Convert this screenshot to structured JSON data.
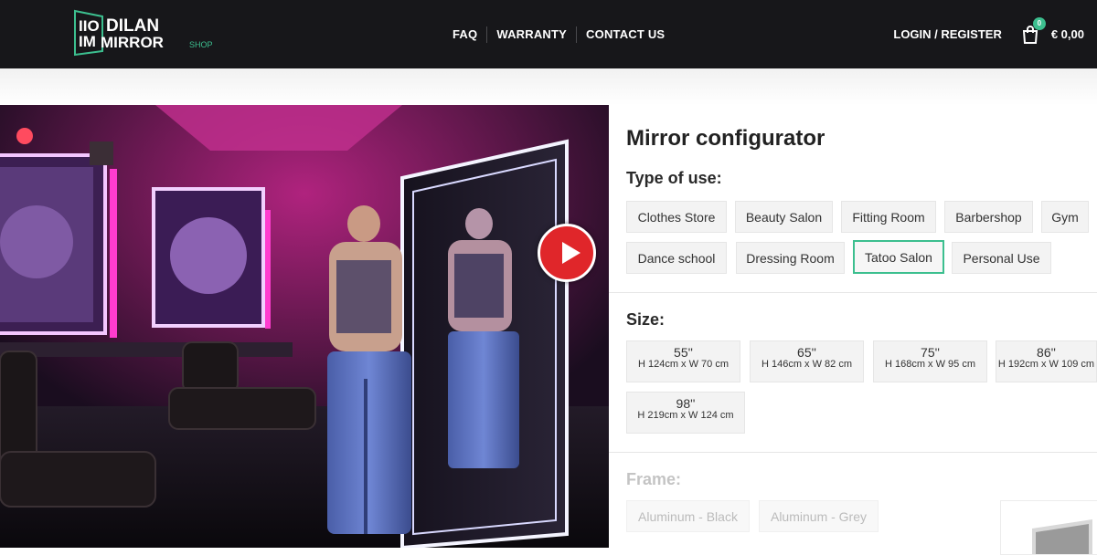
{
  "header": {
    "logo": {
      "line1": "DILAN",
      "line2": "MIRROR",
      "shop": "SHOP"
    },
    "nav": [
      "FAQ",
      "WARRANTY",
      "CONTACT US"
    ],
    "login": "LOGIN / REGISTER",
    "cart_count": "0",
    "cart_total": "€ 0,00"
  },
  "hero": {
    "alt_icon": "play-icon"
  },
  "configurator": {
    "title": "Mirror configurator",
    "type_label": "Type of use:",
    "types": [
      "Clothes Store",
      "Beauty Salon",
      "Fitting Room",
      "Barbershop",
      "Gym",
      "Dance school",
      "Dressing Room",
      "Tatoo Salon",
      "Personal Use"
    ],
    "selected_type": "Tatoo Salon",
    "size_label": "Size:",
    "sizes": [
      {
        "inch": "55''",
        "dims": "H 124cm x W 70 cm"
      },
      {
        "inch": "65''",
        "dims": "H 146cm x W 82 cm"
      },
      {
        "inch": "75''",
        "dims": "H 168cm x W 95 cm"
      },
      {
        "inch": "86''",
        "dims": "H 192cm x W 109 cm"
      },
      {
        "inch": "98''",
        "dims": "H 219cm x W 124 cm"
      }
    ],
    "frame_label": "Frame:",
    "frames": [
      "Aluminum - Black",
      "Aluminum - Grey"
    ]
  },
  "colors": {
    "header_bg": "#17171a",
    "accent": "#3cbf8f",
    "play_red": "#e0262a"
  }
}
